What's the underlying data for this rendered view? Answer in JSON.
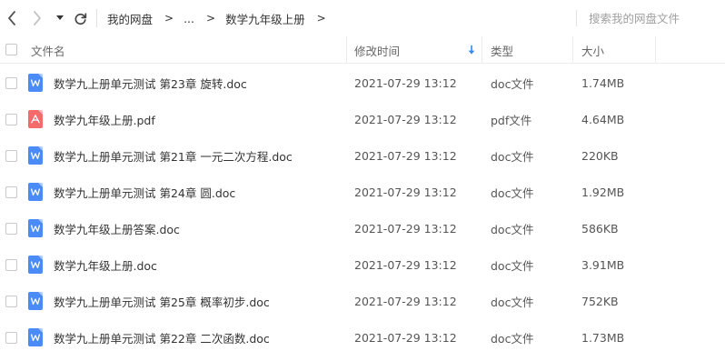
{
  "nav": {
    "breadcrumb": [
      "我的网盘",
      "...",
      "数学九年级上册"
    ],
    "breadcrumb_separator": ">",
    "search_placeholder": "搜索我的网盘文件"
  },
  "table": {
    "headers": {
      "name": "文件名",
      "modified": "修改时间",
      "type": "类型",
      "size": "大小"
    },
    "sort_column": "modified",
    "sort_direction": "descending",
    "rows": [
      {
        "icon": "doc-file-icon",
        "name": "数学九上册单元测试 第23章 旋转.doc",
        "modified": "2021-07-29 13:12",
        "type": "doc文件",
        "size": "1.74MB"
      },
      {
        "icon": "pdf-file-icon",
        "name": "数学九年级上册.pdf",
        "modified": "2021-07-29 13:12",
        "type": "pdf文件",
        "size": "4.64MB"
      },
      {
        "icon": "doc-file-icon",
        "name": "数学九上册单元测试 第21章 一元二次方程.doc",
        "modified": "2021-07-29 13:12",
        "type": "doc文件",
        "size": "220KB"
      },
      {
        "icon": "doc-file-icon",
        "name": "数学九上册单元测试 第24章 圆.doc",
        "modified": "2021-07-29 13:12",
        "type": "doc文件",
        "size": "1.92MB"
      },
      {
        "icon": "doc-file-icon",
        "name": "数学九年级上册答案.doc",
        "modified": "2021-07-29 13:12",
        "type": "doc文件",
        "size": "586KB"
      },
      {
        "icon": "doc-file-icon",
        "name": "数学九年级上册.doc",
        "modified": "2021-07-29 13:12",
        "type": "doc文件",
        "size": "3.91MB"
      },
      {
        "icon": "doc-file-icon",
        "name": "数学九上册单元测试 第25章 概率初步.doc",
        "modified": "2021-07-29 13:12",
        "type": "doc文件",
        "size": "752KB"
      },
      {
        "icon": "doc-file-icon",
        "name": "数学九上册单元测试 第22章  二次函数.doc",
        "modified": "2021-07-29 13:12",
        "type": "doc文件",
        "size": "1.73MB"
      }
    ]
  },
  "colors": {
    "doc_icon": "#4a8cf7",
    "pdf_icon": "#f56b6b",
    "sort_arrow": "#2f8cf5",
    "divider": "#ececec"
  }
}
